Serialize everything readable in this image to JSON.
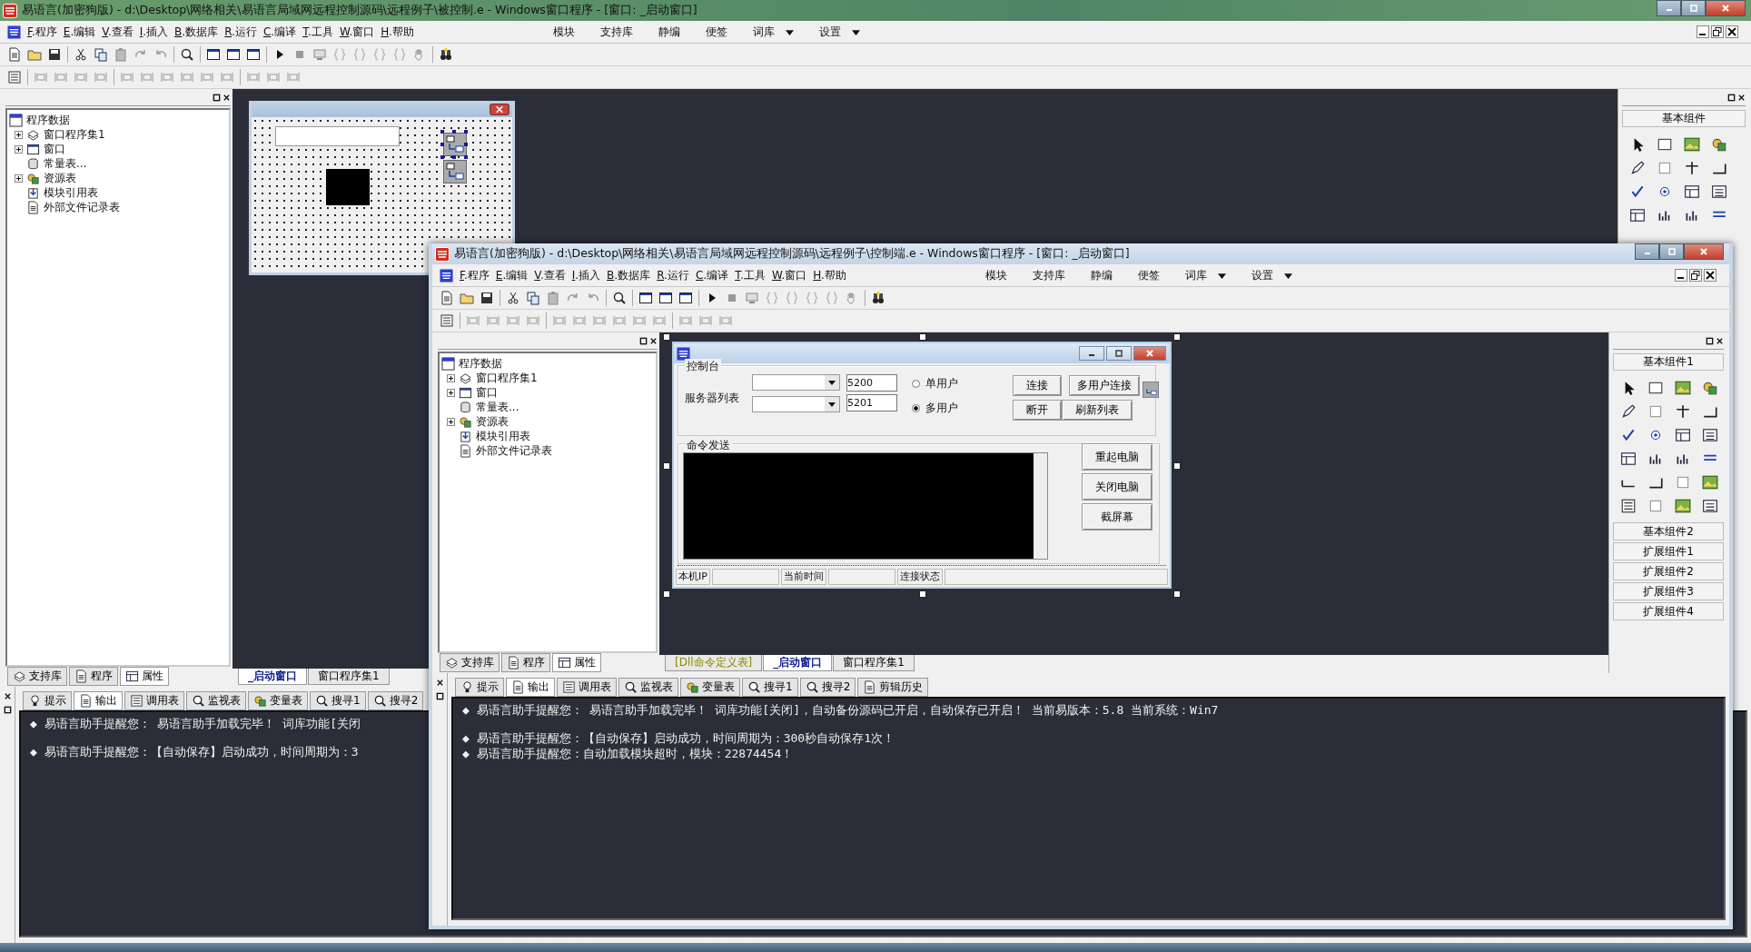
{
  "main_window": {
    "title": "易语言(加密狗版) - d:\\Desktop\\网络相关\\易语言局域网远程控制源码\\远程例子\\被控制.e - Windows窗口程序 - [窗口: _启动窗口]",
    "menu": [
      "F.程序",
      "E.编辑",
      "V.查看",
      "I.插入",
      "B.数据库",
      "R.运行",
      "C.编译",
      "T.工具",
      "W.窗口",
      "H.帮助"
    ],
    "quick_menu": [
      {
        "label": "模块",
        "dropdown": false
      },
      {
        "label": "支持库",
        "dropdown": false
      },
      {
        "label": "静编",
        "dropdown": false
      },
      {
        "label": "便签",
        "dropdown": false
      },
      {
        "label": "词库",
        "dropdown": true
      },
      {
        "label": "设置",
        "dropdown": true
      }
    ],
    "tree": {
      "root": "程序数据",
      "items": [
        {
          "label": "窗口程序集1",
          "kind": "module",
          "expander": true
        },
        {
          "label": "窗口",
          "kind": "window",
          "expander": true
        },
        {
          "label": "常量表...",
          "kind": "constants",
          "expander": false
        },
        {
          "label": "资源表",
          "kind": "resources",
          "expander": true
        },
        {
          "label": "模块引用表",
          "kind": "modules",
          "expander": false
        },
        {
          "label": "外部文件记录表",
          "kind": "file",
          "expander": false
        }
      ]
    },
    "panel_tabs": [
      {
        "label": "支持库",
        "selected": false
      },
      {
        "label": "程序",
        "selected": false
      },
      {
        "label": "属性",
        "selected": true
      }
    ],
    "designer_tabs": [
      {
        "label": "_启动窗口",
        "selected": true
      },
      {
        "label": "窗口程序集1",
        "selected": false
      }
    ],
    "palette": {
      "title": "基本组件"
    },
    "output_tabs": [
      {
        "label": "提示",
        "selected": false
      },
      {
        "label": "输出",
        "selected": true
      },
      {
        "label": "调用表",
        "selected": false
      },
      {
        "label": "监视表",
        "selected": false
      },
      {
        "label": "变量表",
        "selected": false
      },
      {
        "label": "搜寻1",
        "selected": false
      },
      {
        "label": "搜寻2",
        "selected": false
      }
    ],
    "output_lines": [
      {
        "text": "◆  易语言助手提醒您：  易语言助手加载完毕！  词库功能[关闭",
        "blank_before": false
      },
      {
        "text": "◆  易语言助手提醒您：【自动保存】启动成功，时间周期为：3",
        "blank_before": true
      }
    ]
  },
  "inner_window": {
    "title": "易语言(加密狗版) - d:\\Desktop\\网络相关\\易语言局域网远程控制源码\\远程例子\\控制端.e - Windows窗口程序 - [窗口: _启动窗口]",
    "menu": [
      "F.程序",
      "E.编辑",
      "V.查看",
      "I.插入",
      "B.数据库",
      "R.运行",
      "C.编译",
      "T.工具",
      "W.窗口",
      "H.帮助"
    ],
    "quick_menu": [
      {
        "label": "模块",
        "dropdown": false
      },
      {
        "label": "支持库",
        "dropdown": false
      },
      {
        "label": "静编",
        "dropdown": false
      },
      {
        "label": "便签",
        "dropdown": false
      },
      {
        "label": "词库",
        "dropdown": true
      },
      {
        "label": "设置",
        "dropdown": true
      }
    ],
    "tree": {
      "root": "程序数据",
      "items": [
        {
          "label": "窗口程序集1",
          "kind": "module",
          "expander": true
        },
        {
          "label": "窗口",
          "kind": "window",
          "expander": true
        },
        {
          "label": "常量表...",
          "kind": "constants",
          "expander": false
        },
        {
          "label": "资源表",
          "kind": "resources",
          "expander": true
        },
        {
          "label": "模块引用表",
          "kind": "modules",
          "expander": false
        },
        {
          "label": "外部文件记录表",
          "kind": "file",
          "expander": false
        }
      ]
    },
    "panel_tabs": [
      {
        "label": "支持库",
        "selected": false
      },
      {
        "label": "程序",
        "selected": false
      },
      {
        "label": "属性",
        "selected": true
      }
    ],
    "designer_tabs": [
      {
        "label": "[Dll命令定义表]",
        "selected": false
      },
      {
        "label": "_启动窗口",
        "selected": true
      },
      {
        "label": "窗口程序集1",
        "selected": false
      }
    ],
    "form": {
      "console_group": "控制台",
      "server_label": "服务器列表",
      "ports": [
        "5200",
        "5201"
      ],
      "modes": [
        {
          "label": "单用户",
          "selected": false
        },
        {
          "label": "多用户",
          "selected": true
        }
      ],
      "buttons": [
        "连接",
        "多用户连接",
        "断开",
        "刷新列表"
      ],
      "command_group": "命令发送",
      "command_buttons": [
        "重起电脑",
        "关闭电脑",
        "截屏幕"
      ],
      "status": [
        "本机IP",
        "当前时间",
        "连接状态"
      ]
    },
    "palette": {
      "title": "基本组件1",
      "groups": [
        "基本组件2",
        "扩展组件1",
        "扩展组件2",
        "扩展组件3",
        "扩展组件4"
      ]
    },
    "output_tabs": [
      {
        "label": "提示",
        "selected": false
      },
      {
        "label": "输出",
        "selected": true
      },
      {
        "label": "调用表",
        "selected": false
      },
      {
        "label": "监视表",
        "selected": false
      },
      {
        "label": "变量表",
        "selected": false
      },
      {
        "label": "搜寻1",
        "selected": false
      },
      {
        "label": "搜寻2",
        "selected": false
      },
      {
        "label": "剪辑历史",
        "selected": false
      }
    ],
    "output_lines": [
      {
        "text": "◆  易语言助手提醒您：  易语言助手加载完毕！  词库功能[关闭]，自动备份源码已开启，自动保存已开启！  当前易版本：5.8  当前系统：Win7",
        "blank_before": false
      },
      {
        "text": "◆  易语言助手提醒您：【自动保存】启动成功，时间周期为：300秒自动保存1次！",
        "blank_before": true
      },
      {
        "text": "◆  易语言助手提醒您：自动加载模块超时，模块：22874454！",
        "blank_before": false
      }
    ]
  }
}
